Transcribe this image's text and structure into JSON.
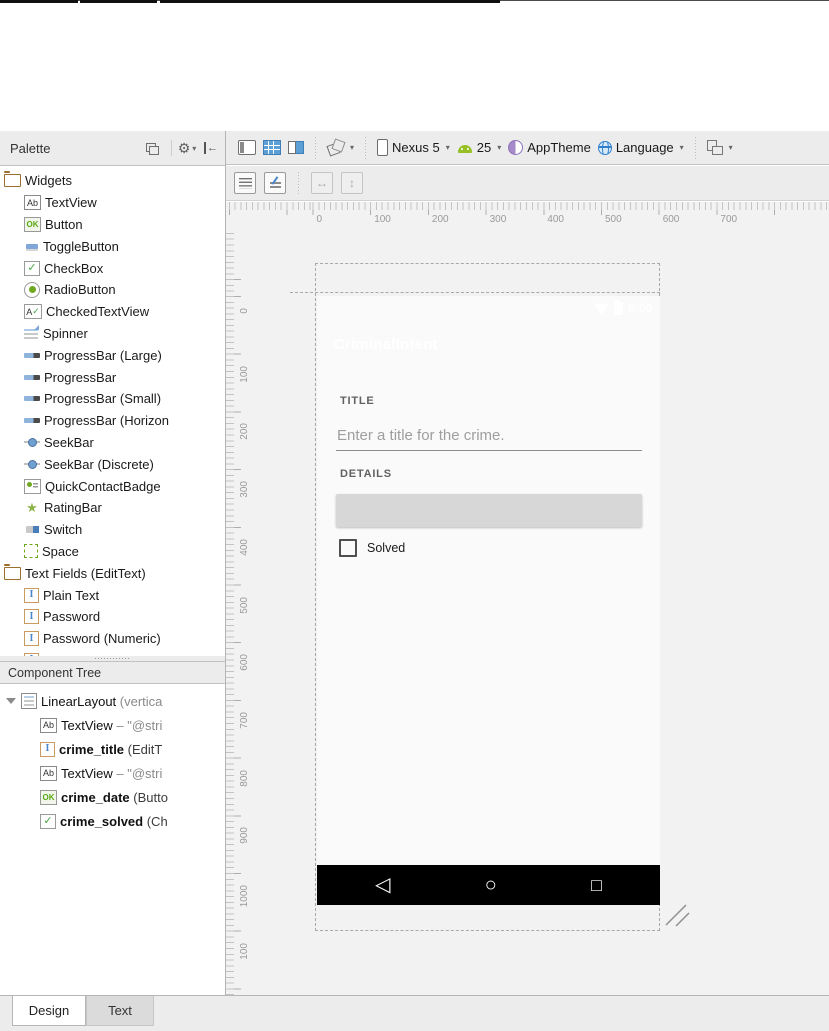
{
  "artifacts": {
    "note": "partial window edge at top"
  },
  "palette": {
    "title": "Palette",
    "header_icons": [
      "preview-options-icon",
      "gear-icon",
      "dock-icon"
    ],
    "rows": [
      {
        "type": "section",
        "icon": "folder",
        "label": "Widgets"
      },
      {
        "type": "item",
        "icon": "textview",
        "label": "TextView"
      },
      {
        "type": "item",
        "icon": "button",
        "label": "Button"
      },
      {
        "type": "item",
        "icon": "togglebutton",
        "label": "ToggleButton"
      },
      {
        "type": "item",
        "icon": "checkbox",
        "label": "CheckBox"
      },
      {
        "type": "item",
        "icon": "radiobutton",
        "label": "RadioButton"
      },
      {
        "type": "item",
        "icon": "checkedtextview",
        "label": "CheckedTextView"
      },
      {
        "type": "item",
        "icon": "spinner",
        "label": "Spinner"
      },
      {
        "type": "item",
        "icon": "progressbar",
        "label": "ProgressBar (Large)"
      },
      {
        "type": "item",
        "icon": "progressbar",
        "label": "ProgressBar"
      },
      {
        "type": "item",
        "icon": "progressbar",
        "label": "ProgressBar (Small)"
      },
      {
        "type": "item",
        "icon": "progressbar",
        "label": "ProgressBar (Horizon"
      },
      {
        "type": "item",
        "icon": "seekbar",
        "label": "SeekBar"
      },
      {
        "type": "item",
        "icon": "seekbar",
        "label": "SeekBar (Discrete)"
      },
      {
        "type": "item",
        "icon": "quickcontactbadge",
        "label": "QuickContactBadge"
      },
      {
        "type": "item",
        "icon": "ratingbar",
        "label": "RatingBar"
      },
      {
        "type": "item",
        "icon": "switch",
        "label": "Switch"
      },
      {
        "type": "item",
        "icon": "space",
        "label": "Space"
      },
      {
        "type": "section",
        "icon": "folder",
        "label": "Text Fields (EditText)"
      },
      {
        "type": "item",
        "icon": "edittext",
        "label": "Plain Text"
      },
      {
        "type": "item",
        "icon": "edittext",
        "label": "Password"
      },
      {
        "type": "item",
        "icon": "edittext",
        "label": "Password (Numeric)"
      },
      {
        "type": "item",
        "icon": "edittext",
        "label": ""
      }
    ]
  },
  "component_tree": {
    "title": "Component Tree",
    "items": [
      {
        "icon": "linearlayout",
        "name": "LinearLayout",
        "detail": "(vertica",
        "expander": true,
        "indent": 0,
        "bold": false
      },
      {
        "icon": "textview",
        "name": "TextView",
        "detail": "– \"@stri",
        "indent": 1,
        "bold": false
      },
      {
        "icon": "edittext",
        "name": "crime_title",
        "detail": "(EditT",
        "indent": 1,
        "bold": true
      },
      {
        "icon": "textview",
        "name": "TextView",
        "detail": "– \"@stri",
        "indent": 1,
        "bold": false
      },
      {
        "icon": "button",
        "name": "crime_date",
        "detail": "(Butto",
        "indent": 1,
        "bold": true
      },
      {
        "icon": "checkbox",
        "name": "crime_solved",
        "detail": "(Ch",
        "indent": 1,
        "bold": true
      }
    ]
  },
  "toolbar": {
    "view_icons": [
      "design-surface-icon",
      "blueprint-surface-icon",
      "both-surfaces-icon"
    ],
    "orientation_icon": "orientation-icon",
    "device_label": "Nexus 5",
    "api_label": "25",
    "theme_label": "AppTheme",
    "language_label": "Language",
    "variant_icon": "layout-variant-icon"
  },
  "toolbar2": {
    "icons": [
      "linearlayout-vertical-icon",
      "convert-view-icon",
      "expand-horizontal-icon",
      "expand-vertical-icon"
    ]
  },
  "rulers": {
    "horizontal": [
      "0",
      "100",
      "200",
      "300",
      "400",
      "500",
      "600",
      "700"
    ],
    "vertical": [
      "0",
      "100",
      "200",
      "300",
      "400",
      "500",
      "600",
      "700",
      "800",
      "900",
      "1000",
      "100"
    ]
  },
  "device": {
    "status_time": "6:00",
    "status_icons": [
      "wifi-icon",
      "battery-icon"
    ],
    "app_title": "CriminalIntent",
    "title_label": "TITLE",
    "title_hint": "Enter a title for the crime.",
    "details_label": "DETAILS",
    "solved_label": "Solved",
    "nav_icons": [
      "back-icon",
      "home-icon",
      "recents-icon"
    ],
    "colors": {
      "status_bar": "#303F9F",
      "app_bar": "#3F51B5",
      "nav_bar": "#000000",
      "accent_blueprint": "#5C9FD6"
    }
  },
  "tabs": {
    "design": "Design",
    "text": "Text"
  }
}
